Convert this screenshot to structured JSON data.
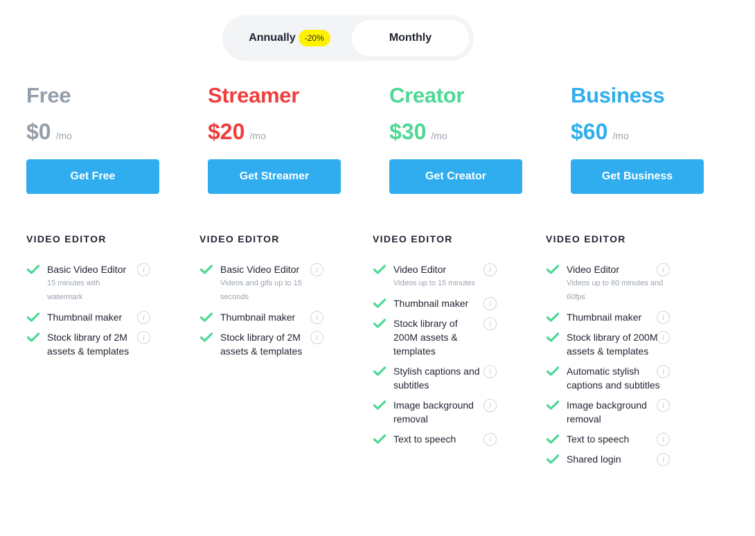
{
  "billing_toggle": {
    "annual_label": "Annually",
    "annual_badge": "-20%",
    "monthly_label": "Monthly",
    "selected": "Monthly"
  },
  "colors": {
    "free": "#939ea9",
    "streamer": "#ef3e3e",
    "creator": "#4dd895",
    "business": "#2fadee",
    "button": "#2fadee",
    "check": "#4dd895",
    "badge": "#fff200"
  },
  "plans": [
    {
      "name": "Free",
      "price": "$0",
      "period": "/mo",
      "cta": "Get Free",
      "section_title": "VIDEO EDITOR",
      "features": [
        {
          "label": "Basic Video Editor",
          "note": "15 minutes with watermark",
          "icon": "check-icon",
          "info_icon": "info-icon"
        },
        {
          "label": "Thumbnail maker",
          "note": "",
          "icon": "check-icon",
          "info_icon": "info-icon"
        },
        {
          "label": "Stock library of 2M assets & templates",
          "note": "",
          "icon": "check-icon",
          "info_icon": "info-icon"
        }
      ]
    },
    {
      "name": "Streamer",
      "price": "$20",
      "period": "/mo",
      "cta": "Get Streamer",
      "section_title": "VIDEO EDITOR",
      "features": [
        {
          "label": "Basic Video Editor",
          "note": "Videos and gifs up to 15 seconds",
          "icon": "check-icon",
          "info_icon": "info-icon"
        },
        {
          "label": "Thumbnail maker",
          "note": "",
          "icon": "check-icon",
          "info_icon": "info-icon"
        },
        {
          "label": "Stock library of 2M assets & templates",
          "note": "",
          "icon": "check-icon",
          "info_icon": "info-icon"
        }
      ]
    },
    {
      "name": "Creator",
      "price": "$30",
      "period": "/mo",
      "cta": "Get Creator",
      "section_title": "VIDEO EDITOR",
      "features": [
        {
          "label": "Video Editor",
          "note": "Videos up to 15 minutes",
          "icon": "check-icon",
          "info_icon": "info-icon"
        },
        {
          "label": "Thumbnail maker",
          "note": "",
          "icon": "check-icon",
          "info_icon": "info-icon"
        },
        {
          "label": "Stock library of 200M assets & templates",
          "note": "",
          "icon": "check-icon",
          "info_icon": "info-icon"
        },
        {
          "label": "Stylish captions and subtitles",
          "note": "",
          "icon": "check-icon",
          "info_icon": "info-icon"
        },
        {
          "label": "Image background removal",
          "note": "",
          "icon": "check-icon",
          "info_icon": "info-icon"
        },
        {
          "label": "Text to speech",
          "note": "",
          "icon": "check-icon",
          "info_icon": "info-icon"
        }
      ]
    },
    {
      "name": "Business",
      "price": "$60",
      "period": "/mo",
      "cta": "Get Business",
      "section_title": "VIDEO EDITOR",
      "features": [
        {
          "label": "Video Editor",
          "note": "Videos up to 60 minutes and 60fps",
          "icon": "check-icon",
          "info_icon": "info-icon"
        },
        {
          "label": "Thumbnail maker",
          "note": "",
          "icon": "check-icon",
          "info_icon": "info-icon"
        },
        {
          "label": "Stock library of 200M assets & templates",
          "note": "",
          "icon": "check-icon",
          "info_icon": "info-icon"
        },
        {
          "label": "Automatic stylish captions and subtitles",
          "note": "",
          "icon": "check-icon",
          "info_icon": "info-icon"
        },
        {
          "label": "Image background removal",
          "note": "",
          "icon": "check-icon",
          "info_icon": "info-icon"
        },
        {
          "label": "Text to speech",
          "note": "",
          "icon": "check-icon",
          "info_icon": "info-icon"
        },
        {
          "label": "Shared login",
          "note": "",
          "icon": "check-icon",
          "info_icon": "info-icon"
        }
      ]
    }
  ],
  "info_glyph": "i"
}
